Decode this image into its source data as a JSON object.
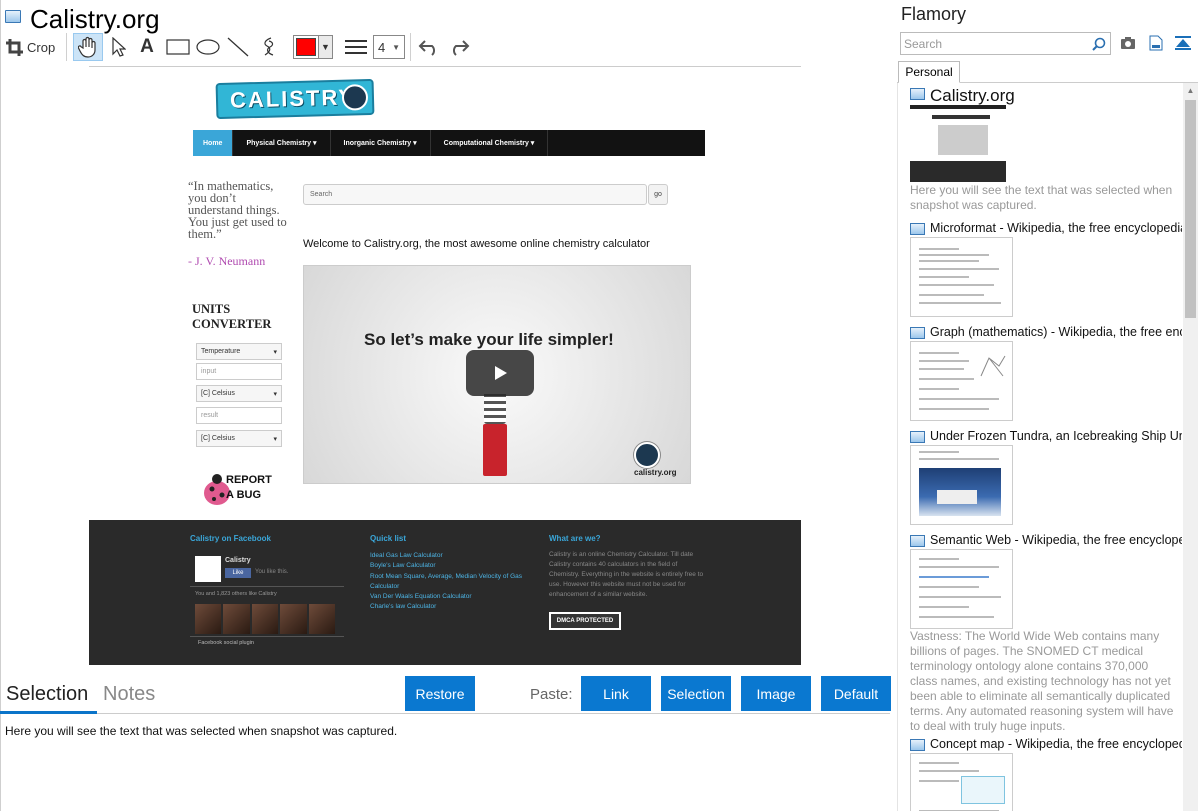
{
  "window": {
    "title": "Calistry.org"
  },
  "toolbar": {
    "crop_label": "Crop",
    "line_width_value": "4",
    "accent_color": "#ff0000"
  },
  "preview": {
    "logo_text": "CALISTRY",
    "nav": [
      "Home",
      "Physical Chemistry",
      "Inorganic Chemistry",
      "Computational Chemistry"
    ],
    "quote": "“In mathematics, you don’t understand things. You just get used to them.”",
    "quote_author": "- J. V. Neumann",
    "units_title": "UNITS CONVERTER",
    "units_fields": [
      "Temperature",
      "input",
      "[C] Celsius",
      "result",
      "[C] Celsius"
    ],
    "bug_text": "REPORT A BUG",
    "search_placeholder": "Search",
    "go_label": "go",
    "welcome": "Welcome to Calistry.org, the most awesome online chemistry calculator",
    "video_caption": "So let’s make your life simpler!",
    "video_badge": "calistry.org",
    "footer": {
      "fb_heading": "Calistry on Facebook",
      "fb_name": "Calistry",
      "fb_like": "Like",
      "fb_you_like": "You like this.",
      "fb_others": "You and 1,823 others like Calistry",
      "fb_plugin": "Facebook social plugin",
      "quick_heading": "Quick list",
      "quick_links": [
        "Ideal Gas Law Calculator",
        "Boyle's Law Calculator",
        "Root Mean Square, Average, Median Velocity of Gas",
        "Calculator",
        "Van Der Waals Equation Calculator",
        "Charle's law Calculator"
      ],
      "what_heading": "What are we?",
      "what_text": "Calistry is an online Chemistry Calculator. Till date Calistry contains 40 calculators in the field of Chemistry. Everything in the website is entirely free to use. However this website must not be used for enhancement of a similar website.",
      "dmca": "DMCA PROTECTED"
    }
  },
  "bottom": {
    "tabs": [
      "Selection",
      "Notes"
    ],
    "restore_label": "Restore",
    "paste_label": "Paste:",
    "paste_buttons": [
      "Link",
      "Selection",
      "Image",
      "Default"
    ],
    "selection_text": "Here you will see the text that was selected when snapshot was captured."
  },
  "flamory": {
    "title": "Flamory",
    "search_placeholder": "Search",
    "tab": "Personal",
    "items": [
      {
        "title": "Calistry.org",
        "note": "Here you will see the text that was selected when snapshot was captured."
      },
      {
        "title": "Microformat - Wikipedia, the free encyclopedia"
      },
      {
        "title": "Graph (mathematics) - Wikipedia, the free ency"
      },
      {
        "title": "Under Frozen Tundra, an Icebreaking Ship Unco"
      },
      {
        "title": "Semantic Web - Wikipedia, the free encycloped",
        "note": "Vastness: The World Wide Web contains many billions of pages. The SNOMED CT medical terminology ontology alone contains 370,000 class names, and existing technology has not yet been able to eliminate all semantically duplicated terms. Any automated reasoning system will have to deal with truly huge inputs."
      },
      {
        "title": "Concept map - Wikipedia, the free encyclopedia"
      }
    ]
  }
}
